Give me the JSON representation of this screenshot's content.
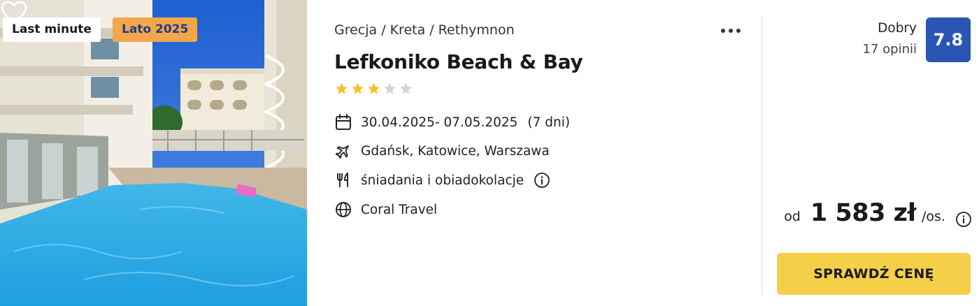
{
  "badges": {
    "last_minute": "Last minute",
    "season": "Lato 2025"
  },
  "icons": {
    "favorite": "heart-outline-icon",
    "more": "more-dots-icon",
    "calendar": "calendar-icon",
    "flight": "airplane-icon",
    "meals": "fork-knife-icon",
    "organizer": "globe-icon",
    "info": "info-circle-icon"
  },
  "breadcrumb": {
    "country": "Grecja",
    "region": "Kreta",
    "city": "Rethymnon",
    "separator": "/"
  },
  "hotel": {
    "name": "Lefkoniko Beach & Bay",
    "stars": 3,
    "max_stars": 5
  },
  "trip": {
    "dates": "30.04.2025- 07.05.2025",
    "duration": "(7 dni)",
    "departures": "Gdańsk, Katowice, Warszawa",
    "board": "śniadania i obiadokolacje",
    "organizer": "Coral Travel"
  },
  "rating": {
    "label": "Dobry",
    "reviews": "17 opinii",
    "score": "7.8"
  },
  "price": {
    "prefix": "od",
    "amount": "1 583 zł",
    "suffix": "/os."
  },
  "cta": {
    "label": "SPRAWDŹ CENĘ"
  },
  "colors": {
    "star_filled": "#f2c230",
    "star_empty": "#d4d4d4",
    "rating_badge": "#2a55b5",
    "cta": "#f5cf48",
    "season_badge": "#f3a64a",
    "season_text": "#1f3e85"
  }
}
